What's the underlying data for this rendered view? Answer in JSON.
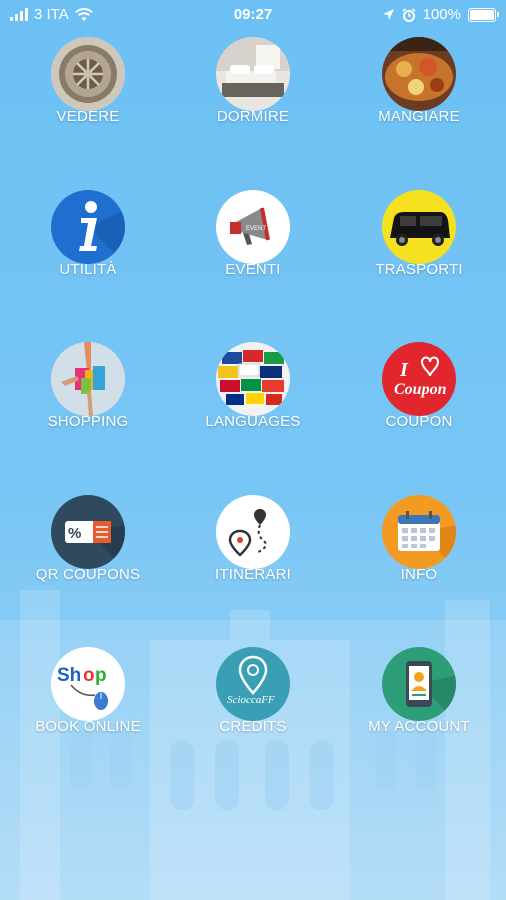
{
  "status": {
    "carrier": "3 ITA",
    "time": "09:27",
    "battery": "100%"
  },
  "menu": [
    {
      "label": "VEDERE",
      "icon": "manhole-cover-icon"
    },
    {
      "label": "DORMIRE",
      "icon": "hotel-room-icon"
    },
    {
      "label": "MANGIARE",
      "icon": "food-plate-icon"
    },
    {
      "label": "UTILITÀ",
      "icon": "info-icon"
    },
    {
      "label": "EVENTI",
      "icon": "megaphone-icon"
    },
    {
      "label": "TRASPORTI",
      "icon": "van-icon"
    },
    {
      "label": "SHOPPING",
      "icon": "shopping-bags-icon"
    },
    {
      "label": "LANGUAGES",
      "icon": "flags-globe-icon"
    },
    {
      "label": "COUPON",
      "icon": "coupon-heart-icon"
    },
    {
      "label": "QR COUPONS",
      "icon": "percent-ticket-icon"
    },
    {
      "label": "ITINERARI",
      "icon": "route-pin-icon"
    },
    {
      "label": "INFO",
      "icon": "calendar-icon"
    },
    {
      "label": "BOOK ONLINE",
      "icon": "shop-mouse-icon"
    },
    {
      "label": "CREDITS",
      "icon": "location-pin-icon"
    },
    {
      "label": "MY ACCOUNT",
      "icon": "phone-user-icon"
    }
  ],
  "logos": {
    "coupon_text": "I ♥ Coupon",
    "shop_text": "Shop",
    "credits_text": "ScioccaFF"
  }
}
